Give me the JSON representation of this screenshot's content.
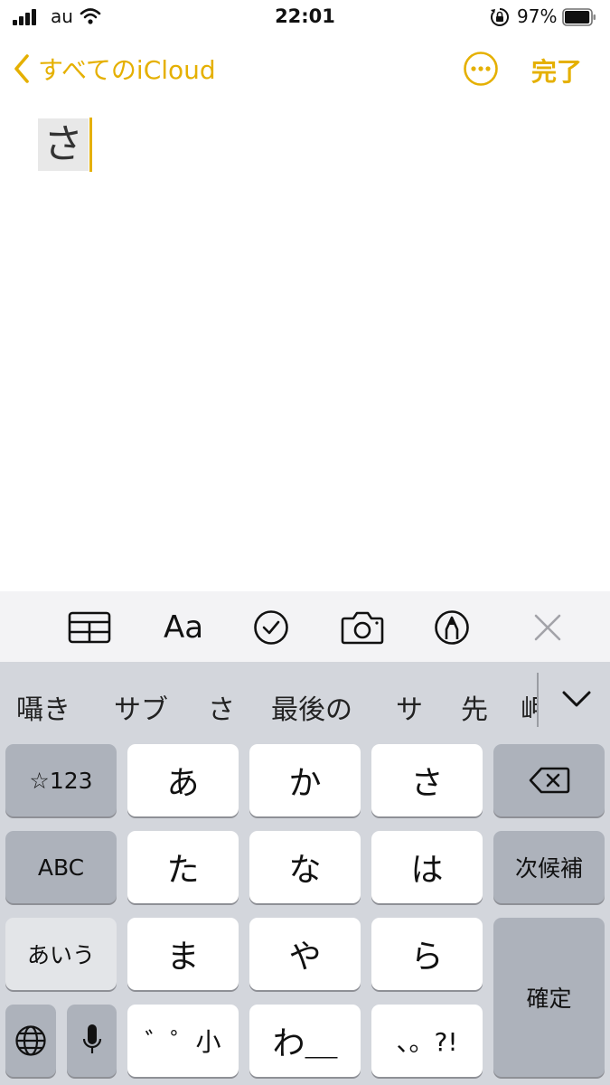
{
  "status_bar": {
    "carrier": "au",
    "time": "22:01",
    "battery_percent": "97%",
    "battery_level": 0.97,
    "icons": [
      "signal-icon",
      "wifi-icon",
      "orientation-lock-icon",
      "battery-icon"
    ]
  },
  "nav": {
    "back_label": "すべてのiCloud",
    "done_label": "完了",
    "accent_color": "#e5b000"
  },
  "note": {
    "composing_text": "さ"
  },
  "format_toolbar": {
    "aa_label": "Aa",
    "icons": [
      "table-icon",
      "text-format-icon",
      "checklist-icon",
      "camera-icon",
      "markup-icon",
      "close-icon"
    ]
  },
  "keyboard": {
    "candidates": [
      "囁き",
      "サブ",
      "さ",
      "最後の",
      "サ",
      "先",
      "岬"
    ],
    "keys": {
      "sym": "☆123",
      "abc": "ABC",
      "hira": "あいう",
      "r1": [
        "あ",
        "か",
        "さ"
      ],
      "r2": [
        "た",
        "な",
        "は"
      ],
      "r3": [
        "ま",
        "や",
        "ら"
      ],
      "r4": [
        "゛゜小",
        "わ＿",
        "、。?!"
      ],
      "next": "次候補",
      "confirm": "確定"
    }
  }
}
